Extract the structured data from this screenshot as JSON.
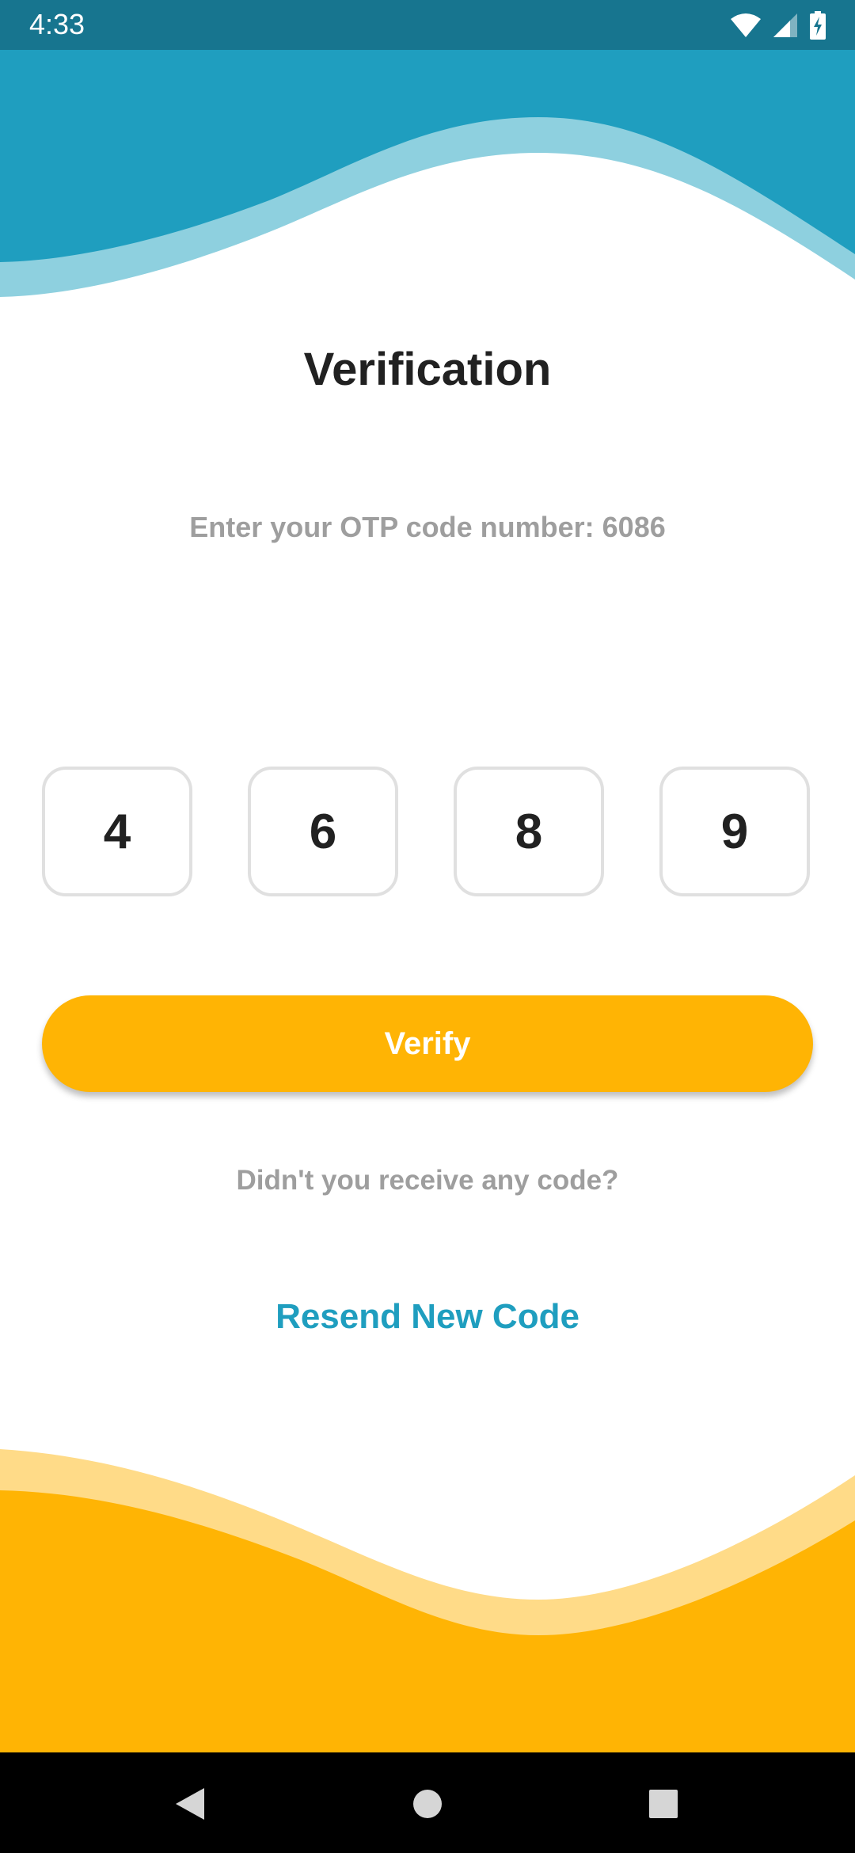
{
  "status_bar": {
    "time": "4:33",
    "icons": [
      "wifi-icon",
      "cell-signal-icon",
      "battery-charging-icon"
    ]
  },
  "verification": {
    "title": "Verification",
    "instruction": "Enter your OTP code number: 6086",
    "otp_digits": [
      "4",
      "6",
      "8",
      "9"
    ],
    "verify_label": "Verify",
    "resend_prompt": "Didn't you receive any code?",
    "resend_label": "Resend New Code"
  },
  "navigation": {
    "buttons": [
      "back-icon",
      "home-icon",
      "recents-icon"
    ]
  },
  "colors": {
    "status_bar": "#17758f",
    "header_wave": "#1f9ebf",
    "header_wave_light": "#8ed0df",
    "accent_yellow": "#ffb404",
    "footer_wave_light": "#ffdb88",
    "link_blue": "#1f9ebf"
  }
}
